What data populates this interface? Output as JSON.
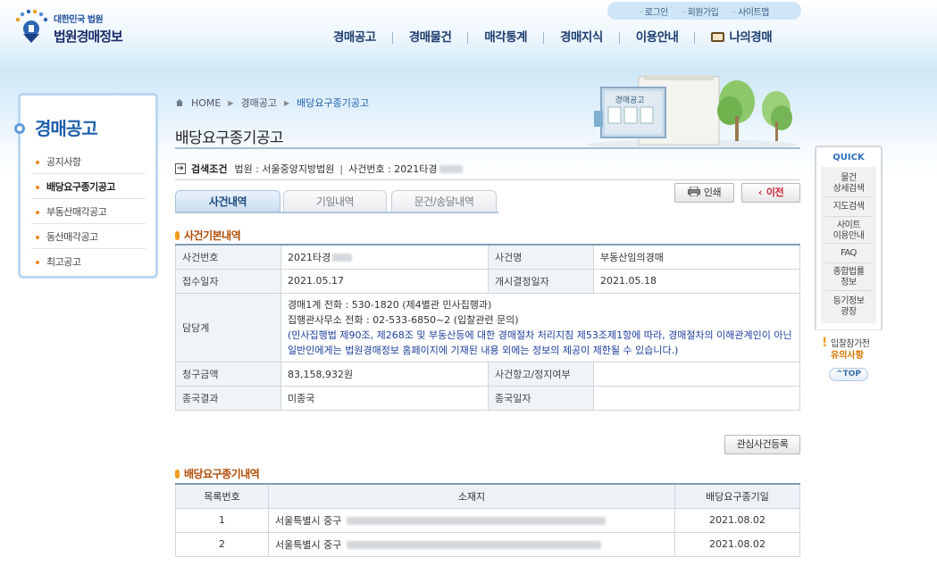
{
  "logo": {
    "line1": "대한민국 법원",
    "line2": "법원경매정보"
  },
  "util": [
    "로그인",
    "회원가입",
    "사이트맵"
  ],
  "gnb": [
    "경매공고",
    "경매물건",
    "매각통계",
    "경매지식",
    "이용안내",
    "나의경매"
  ],
  "lnb": {
    "title": "경매공고",
    "items": [
      "공지사항",
      "배당요구종기공고",
      "부동산매각공고",
      "동산매각공고",
      "최고공고"
    ]
  },
  "breadcrumb": [
    "HOME",
    "경매공고",
    "배당요구종기공고"
  ],
  "page_title": "배당요구종기공고",
  "illustration_sign": "경매공고",
  "search_cond": {
    "label": "검색조건",
    "court": "법원 : 서울중앙지방법원",
    "case": "사건번호 : 2021타경"
  },
  "tabs": [
    "사건내역",
    "기일내역",
    "문건/송달내역"
  ],
  "buttons": {
    "print": "인쇄",
    "prev": "이전",
    "register": "관심사건등록"
  },
  "section1": "사건기본내역",
  "info": {
    "case_no_label": "사건번호",
    "case_no": "2021타경",
    "case_name_label": "사건명",
    "case_name": "부동산임의경매",
    "receipt_label": "접수일자",
    "receipt": "2021.05.17",
    "start_label": "개시결정일자",
    "start": "2021.05.18",
    "dept_label": "담당계",
    "dept_line1": "경매1계    전화 : 530-1820 (제4별관 민사집행과)",
    "dept_line2": "집행관사무소    전화 : 02-533-6850~2 (입찰관련 문의)",
    "dept_line3": "(민사집행법 제90조, 제268조 및 부동산등에 대한 경매절차 처리지침 제53조제1항에 따라, 경매절차의 이해관계인이 아닌 일반인에게는 법원경매정보 홈페이지에 기재된 내용 외에는 정보의 제공이 제한될 수 있습니다.)",
    "claim_label": "청구금액",
    "claim": "83,158,932원",
    "appeal_label": "사건항고/정지여부",
    "appeal": "",
    "end_label": "종국결과",
    "end": "미종국",
    "end_date_label": "종국일자",
    "end_date": ""
  },
  "section2": "배당요구종기내역",
  "list": {
    "headers": [
      "목록번호",
      "소재지",
      "배당요구종기일"
    ],
    "rows": [
      {
        "no": "1",
        "addr": "서울특별시 중구",
        "date": "2021.08.02"
      },
      {
        "no": "2",
        "addr": "서울특별시 중구",
        "date": "2021.08.02"
      }
    ]
  },
  "quick": {
    "title": "QUICK",
    "items": [
      "물건\n상세검색",
      "지도검색",
      "사이트\n이용안내",
      "FAQ",
      "종합법률\n정보",
      "등기정보\n광장"
    ],
    "warn1": "입찰참가전",
    "warn2": "유의사항",
    "top": "TOP"
  }
}
